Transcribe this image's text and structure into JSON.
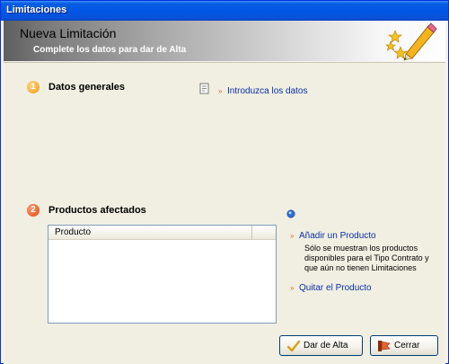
{
  "window": {
    "title": "Limitaciones"
  },
  "banner": {
    "title": "Nueva Limitación",
    "subtitle": "Complete los datos para dar de Alta"
  },
  "section1": {
    "number": "1",
    "label": "Datos generales",
    "link": "Introduzca los datos"
  },
  "section2": {
    "number": "2",
    "label": "Productos afectados",
    "table": {
      "columns": [
        "Producto"
      ],
      "rows": []
    },
    "add_link": "Añadir un Producto",
    "hint": "Sólo se muestran los productos disponibles para el Tipo Contrato y que aún no tienen Limitaciones",
    "remove_link": "Quitar el Producto"
  },
  "buttons": {
    "alta": "Dar de Alta",
    "cerrar": "Cerrar"
  },
  "colors": {
    "title_bar": "#0055e5",
    "link": "#0a2fa8",
    "accent_orange": "#e6642c"
  }
}
